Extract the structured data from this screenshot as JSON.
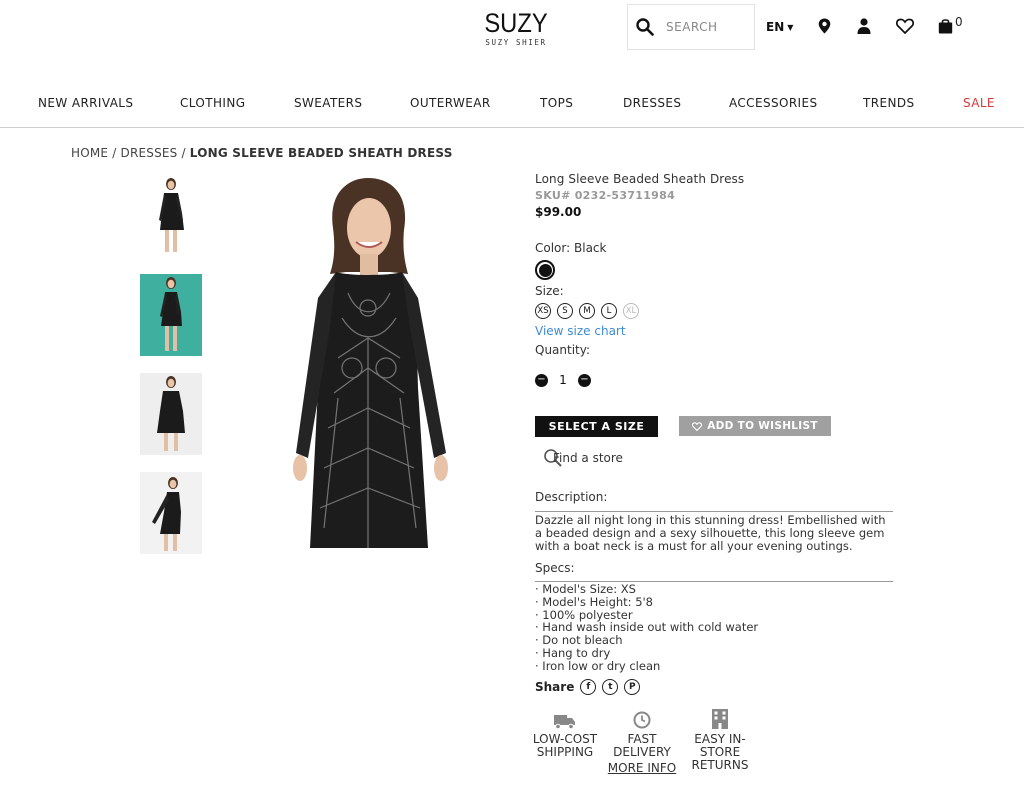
{
  "header": {
    "logo_main": "SUZY",
    "logo_sub": "SUZY SHIER",
    "search_placeholder": "SEARCH",
    "lang": "EN",
    "cart_count": "0"
  },
  "nav": [
    {
      "label": "NEW ARRIVALS"
    },
    {
      "label": "CLOTHING"
    },
    {
      "label": "SWEATERS"
    },
    {
      "label": "OUTERWEAR"
    },
    {
      "label": "TOPS"
    },
    {
      "label": "DRESSES"
    },
    {
      "label": "ACCESSORIES"
    },
    {
      "label": "TRENDS"
    },
    {
      "label": "SALE"
    }
  ],
  "breadcrumb": {
    "home": "HOME",
    "sep1": " / ",
    "category": "DRESSES",
    "sep2": " / ",
    "current": "LONG SLEEVE BEADED SHEATH DRESS"
  },
  "product": {
    "title": "Long Sleeve Beaded Sheath Dress",
    "sku": "SKU# 0232-53711984",
    "price": "$99.00",
    "color_label": "Color:",
    "color_value": "Black",
    "size_label": "Size:",
    "sizes": [
      {
        "label": "XS",
        "available": true
      },
      {
        "label": "S",
        "available": true
      },
      {
        "label": "M",
        "available": true
      },
      {
        "label": "L",
        "available": true
      },
      {
        "label": "XL",
        "available": false
      }
    ],
    "size_chart": "View size chart",
    "quantity_label": "Quantity:",
    "quantity": "1",
    "select_size": "SELECT A SIZE",
    "add_wishlist": "ADD TO WISHLIST",
    "find_store": "Find a store",
    "description_label": "Description:",
    "description": "Dazzle all night long in this stunning dress! Embellished with a beaded design and a sexy silhouette, this long sleeve gem with a boat neck is a must for all your evening outings.",
    "specs_label": "Specs:",
    "specs": [
      "· Model's Size: XS",
      "· Model's Height: 5'8",
      "· 100% polyester",
      "· Hand wash inside out with cold water",
      "· Do not bleach",
      "· Hang to dry",
      "· Iron low or dry clean"
    ],
    "share_label": "Share"
  },
  "perks": [
    {
      "label": "LOW-COST SHIPPING",
      "icon": "truck-icon"
    },
    {
      "label": "FAST DELIVERY",
      "icon": "clock-icon"
    },
    {
      "label": "EASY IN-STORE RETURNS",
      "icon": "building-icon"
    }
  ],
  "more_info": "MORE INFO",
  "colors": {
    "sale": "#d63a3a",
    "link": "#3d8bd6",
    "thumb_teal": "#3fb0a0",
    "wishlist_btn": "#a0a0a0"
  }
}
